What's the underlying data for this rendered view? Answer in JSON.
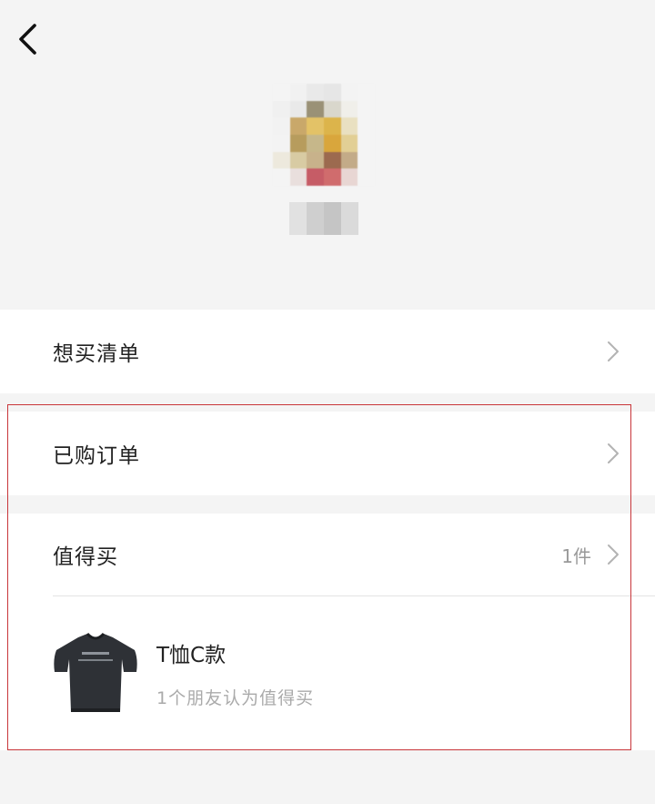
{
  "header": {
    "back_icon": "chevron-left-icon"
  },
  "profile": {
    "avatar_colors": [
      "#f4f4f4",
      "#f1f1f1",
      "#e9e9e9",
      "#e6e6e6",
      "#f3f3f3",
      "#f4f4f4",
      "#f0f0f0",
      "#e9e9e9",
      "#9a9176",
      "#d9d7cc",
      "#f0efea",
      "#f4f4f4",
      "#f2f2f2",
      "#c9a86a",
      "#e3c267",
      "#dcb44b",
      "#e9e0c1",
      "#f4f4f4",
      "#f3f3f3",
      "#b79c5d",
      "#c6b78a",
      "#d9a63c",
      "#e2cf95",
      "#f4f4f4",
      "#ede9dd",
      "#d8cba3",
      "#c8b28b",
      "#9c6a4f",
      "#c3ab88",
      "#f4f4f4",
      "#f4f4f4",
      "#e9dfdd",
      "#c65c66",
      "#d06c6d",
      "#e8d6d3",
      "#f4f4f4"
    ]
  },
  "menu": {
    "wishlist": {
      "label": "想买清单"
    },
    "orders": {
      "label": "已购订单"
    },
    "worth_buying": {
      "label": "值得买",
      "count": "1件"
    }
  },
  "product": {
    "name": "T恤C款",
    "subtitle": "1个朋友认为值得买"
  },
  "colors": {
    "highlight_border": "#c8363a",
    "background": "#f4f4f4",
    "row_background": "#ffffff",
    "secondary_text": "#aaaaaa"
  }
}
